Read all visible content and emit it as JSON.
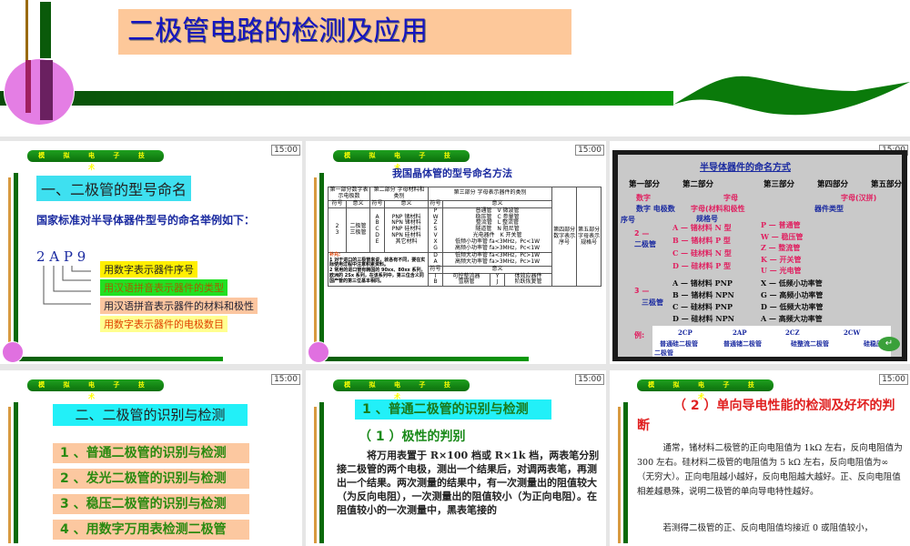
{
  "title_slide": {
    "title": "二极管电路的检测及应用"
  },
  "common": {
    "header": "模 拟 电 子 技 术",
    "time": "15:00"
  },
  "slide1": {
    "heading": "一、二极管的型号命名",
    "intro": "国家标准对半导体器件型号的命名举例如下：",
    "code": "2 A P 9",
    "labels": [
      "用数字表示器件序号",
      "用汉语拼音表示器件的类型",
      "用汉语拼音表示器件的材料和极性",
      "用数字表示器件的电极数目"
    ]
  },
  "slide2": {
    "title": "我国晶体管的型号命名方法",
    "part1": "第一部分数字表示电极数",
    "part2": "第二部分 字母材料和类别",
    "part3": "第三部分 字母表示器件的类别",
    "part4": "第四部分数字表示序号",
    "part5": "第五部分字母表示规格号",
    "symbol": "符号",
    "meaning": "意义",
    "p1_symbols": "2\n3",
    "p1_meanings": "二极管\n三极管",
    "p2_symbols": "A\nB\nC\nD\nE",
    "p2_meanings": "PNP 锗材料\nNPN 锗材料\nPNP 硅材料\nNPN 硅材料\n其它材料",
    "p3_symbols": "P\nW\nZ\nS\nV\nX\nG",
    "p3_meanings": "普通管　V 微波管\n稳压管　C 参量管\n整流管　L 整流管\n隧道管　N 阻尼管\n光电器件　K 开关管\n低频小功率管 fa<3MHz，Pc<1W\n高频小功率管 fa>3MHz，Pc<1W",
    "p3b_symbols": "D\nA",
    "p3b_meanings": "低频大功率管 fa<3MHz，Pc>1W\n高频大功率管 fa>3MHz，Pc>1W",
    "p3c_symbols": "I\nB",
    "p3c_meanings": "可控整流器\n雪崩管",
    "p3c_symbols2": "Y\nJ",
    "p3c_meanings2": "体效应器件\n阶跃恢复管",
    "note_title": "补充:",
    "note": "1 对于进口的三极管来说，就各有不同，要在实际使用过程中注意积累资料。\n2 常用的进口管有韩国的 90xx、80xx 系列，欧洲的 2Sx 系列，在该系列中，第三位含义同国产管的第三位基本相同。"
  },
  "slide3": {
    "title": "半导体器件的命名方式",
    "parts": [
      "第一部分",
      "第二部分",
      "第三部分",
      "第四部分",
      "第五部分"
    ],
    "sub1": "数字",
    "sub1b": "数字 电极数",
    "sub2": "字母",
    "sub2b": "字母(材料和极性",
    "sub4": "器件类型",
    "sub5": "字母(汉拼)",
    "seq": "序号",
    "spec": "规格号",
    "d2": "2 —",
    "d2b": "二极管",
    "d3": "3 —",
    "d3b": "三极管",
    "mat_diode": [
      "A — 锗材料  N 型",
      "B — 锗材料  P 型",
      "C — 硅材料  N 型",
      "D — 硅材料  P 型"
    ],
    "mat_tri": [
      "A — 锗材料  PNP",
      "B — 锗材料  NPN",
      "C — 硅材料  PNP",
      "D — 硅材料  NPN"
    ],
    "type_diode": [
      "P — 普通管",
      "W — 稳压管",
      "Z — 整流管",
      "K — 开关管",
      "U — 光电管"
    ],
    "type_tri": [
      "X — 低频小功率管",
      "G — 高频小功率管",
      "D — 低频大功率管",
      "A — 高频大功率管"
    ],
    "example_label": "例:",
    "examples": [
      "2CP",
      "2AP",
      "2CZ",
      "2CW"
    ],
    "example_desc": [
      "普通硅二极管",
      "普通锗二极管",
      "硅整流二极管",
      "硅稳压",
      "二极管"
    ]
  },
  "slide4": {
    "heading": "二、二极管的识别与检测",
    "items": [
      "1 、普通二极管的识别与检测",
      "2 、发光二极管的识别与检测",
      "3 、稳压二极管的识别与检测",
      "4 、用数字万用表检测二极管"
    ]
  },
  "slide5": {
    "heading": "1 、普通二极管的识别与检测",
    "sub": "（ 1 ）极性的判别",
    "body": "　　　将万用表置于 R×100 档或 R×1k 档，两表笔分别接二极管的两个电极，测出一个结果后，对调两表笔，再测出一个结果。两次测量的结果中，有一次测量出的阻值较大（为反向电阻），一次测量出的阻值较小（为正向电阻）。在阻值较小的一次测量中，黑表笔接的"
  },
  "slide6": {
    "heading": "（ 2 ）单向导电性能的检测及好坏的判断",
    "body1": "　　　通常，锗材料二极管的正向电阻值为 1kΩ 左右，反向电阻值为 300 左右。硅材料二极管的电阻值为 5 kΩ 左右，反向电阻值为∞（无穷大）。正向电阻越小越好，反向电阻越大越好。正、反向电阻值相差越悬殊，说明二极管的单向导电特性越好。",
    "body2": "　　　若测得二极管的正、反向电阻值均接近 0 或阻值较小，"
  }
}
